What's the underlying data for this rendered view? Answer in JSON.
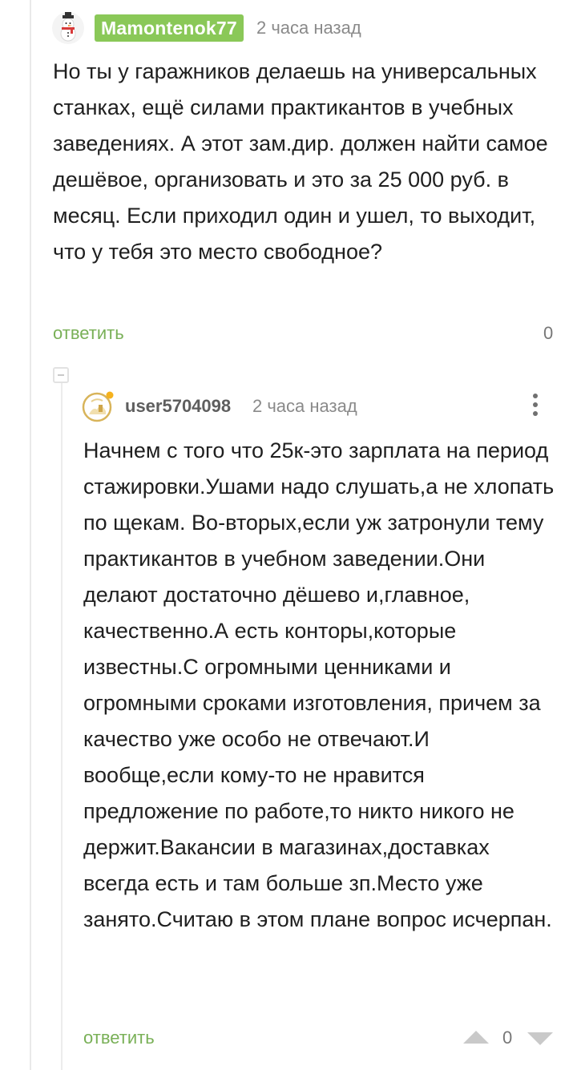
{
  "comments": [
    {
      "author": "Mamontenok77",
      "time": "2 часа назад",
      "avatar_icon": "snowman-icon",
      "badge_color": "#8ac858",
      "text": "Но ты у гаражников делаешь на универсальных станках, ещё силами практикантов в учебных заведениях. А этот зам.дир. должен найти самое дешёвое, организовать и это за 25 000 руб. в месяц. Если приходил один и ушел, то выходит, что у тебя это место свободное?",
      "reply_label": "ответить",
      "score": "0"
    },
    {
      "author": "user5704098",
      "time": "2 часа назад",
      "avatar_icon": "user-avatar-icon",
      "text": "Начнем с того что 25к-это зарплата на период стажировки.Ушами надо слушать,а не хлопать по щекам. Во-вторых,если уж затронули тему практикантов в учебном заведении.Они делают достаточно дёшево и,главное, качественно.А есть конторы,которые известны.С огромными ценниками и огромными сроками изготовления, причем за качество уже особо не отвечают.И вообще,если кому-то не нравится предложение по работе,то никто никого не держит.Вакансии в магазинах,доставках всегда есть и там больше зп.Место уже занято.Считаю в этом плане вопрос исчерпан.",
      "reply_label": "ответить",
      "score": "0"
    }
  ],
  "colors": {
    "accent_green": "#79b057",
    "muted": "#8a8a8a"
  }
}
